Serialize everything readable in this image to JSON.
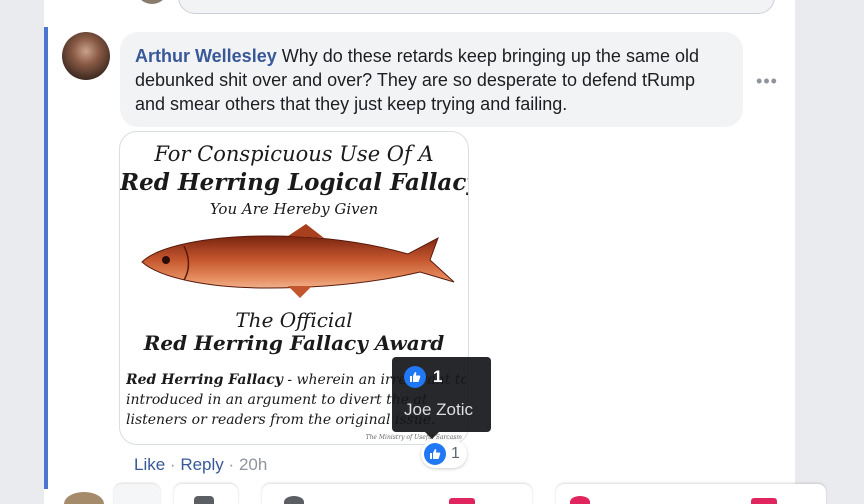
{
  "comment": {
    "author": "Arthur Wellesley",
    "text": "Why do these retards keep bringing up the same old debunked shit over and over? They are so desperate to defend tRump and smear others that they just keep trying and failing.",
    "more_label": "•••"
  },
  "image": {
    "line1": "For Conspicuous Use Of A",
    "line2": "Red Herring Logical Fallacy",
    "line3": "You Are Hereby Given",
    "line4": "The Official",
    "line5": "Red Herring Fallacy Award",
    "desc_term": "Red Herring Fallacy",
    "desc_rest": " - wherein an irrelevant to",
    "desc_line2": "introduced in an argument to divert the at",
    "desc_line3": "listeners or readers from the original issue.",
    "footer": "The Ministry of Useful Sarcasm"
  },
  "actions": {
    "like": "Like",
    "reply": "Reply",
    "time": "20h",
    "sep": "·"
  },
  "reactions": {
    "count": "1",
    "icon": "like-icon",
    "color": "#2078f4"
  },
  "tooltip": {
    "count": "1",
    "name": "Joe Zotic"
  },
  "colors": {
    "thread_line": "#4a76d0",
    "author": "#385898",
    "bubble": "#f2f3f5"
  }
}
